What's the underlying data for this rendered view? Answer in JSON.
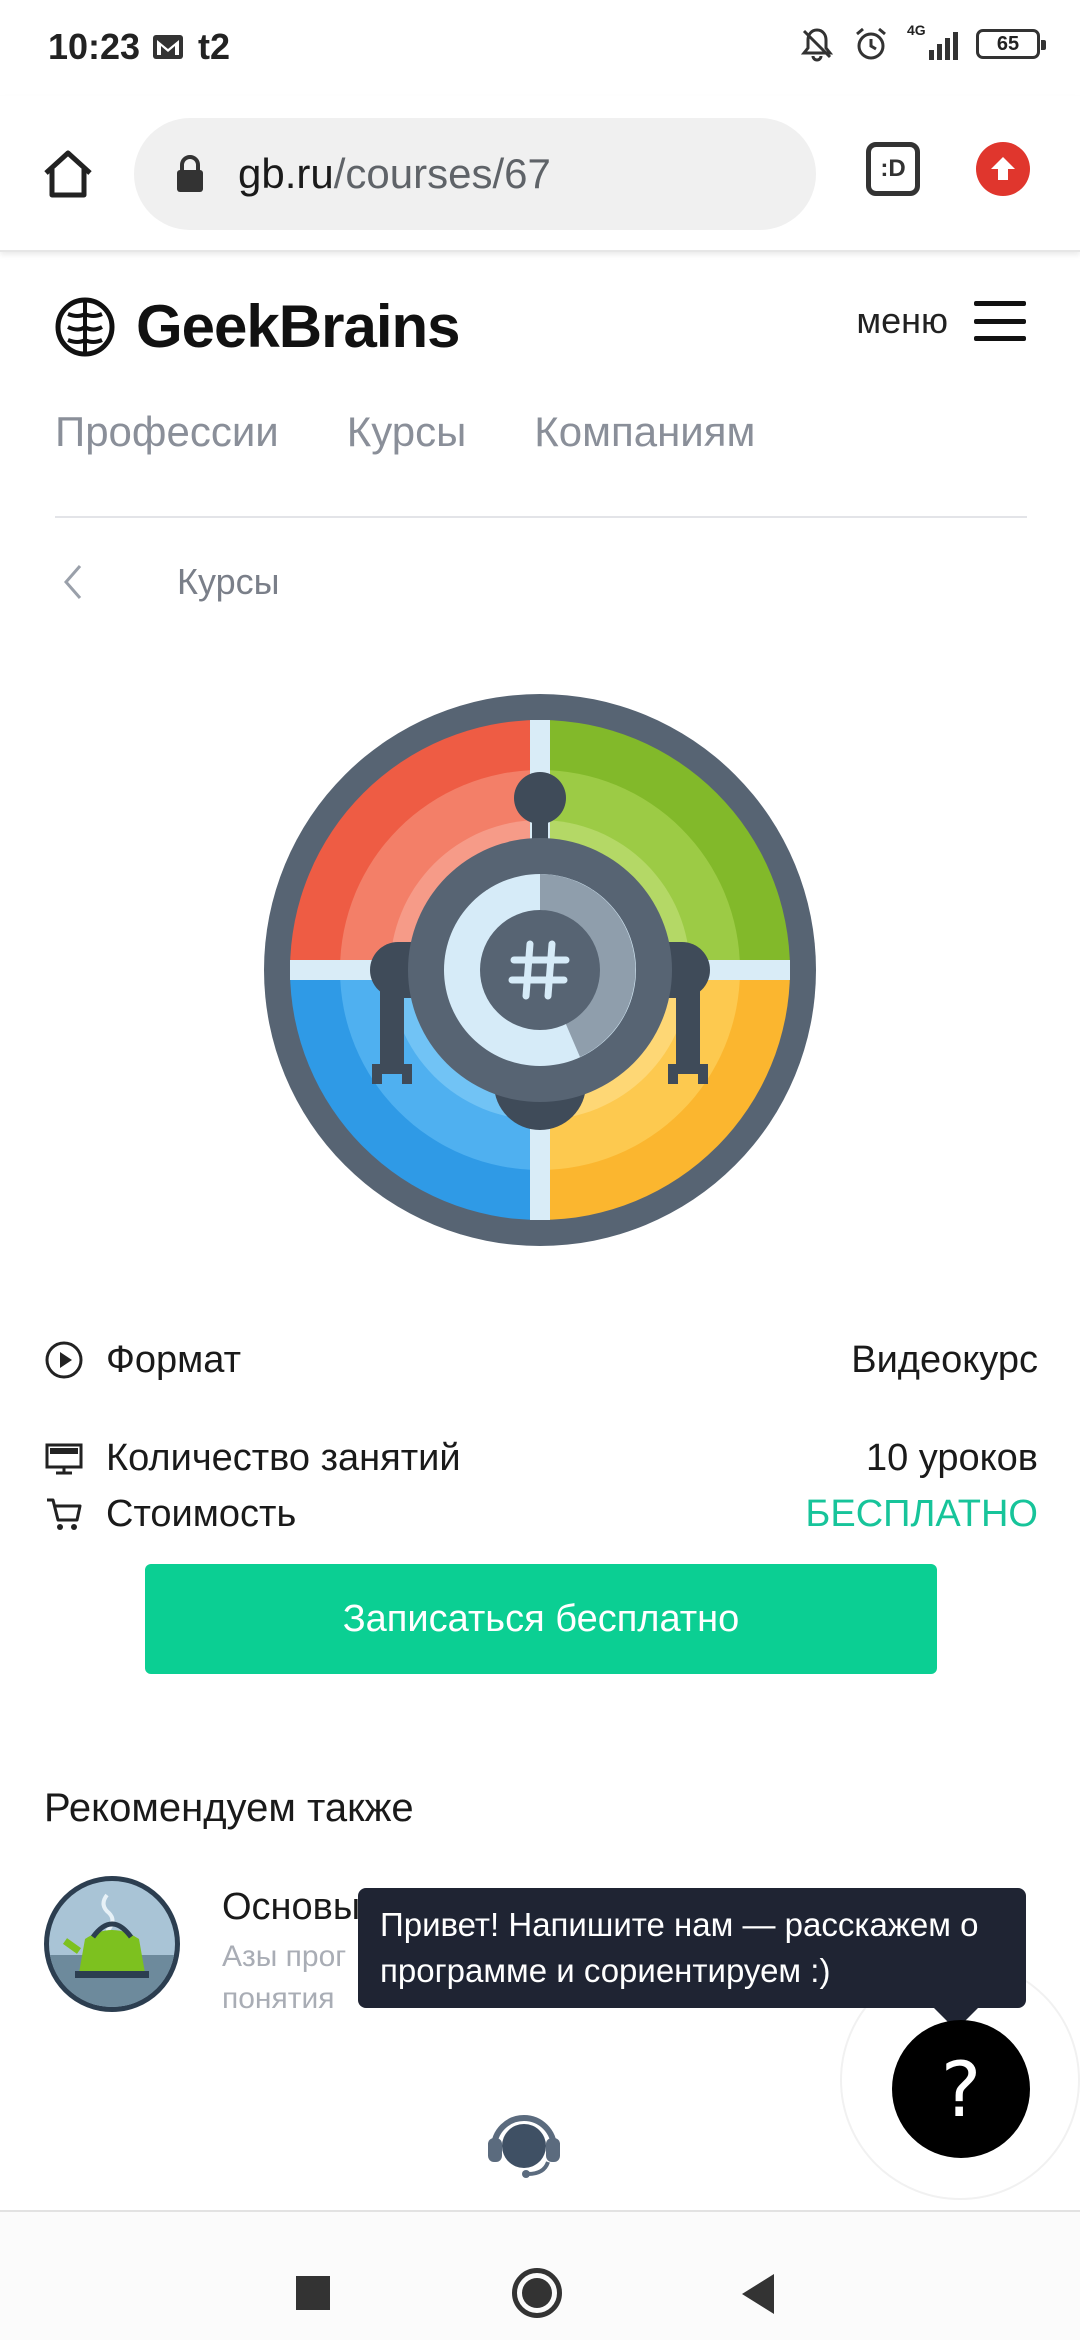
{
  "status_bar": {
    "time": "10:23",
    "carrier": "t2",
    "network": "4G",
    "battery": "65",
    "icons": [
      "gmail-icon",
      "bell-off-icon",
      "alarm-icon",
      "signal-icon"
    ]
  },
  "browser": {
    "url_domain": "gb.ru",
    "url_path": "/courses/67",
    "tabs_label": ":D"
  },
  "site": {
    "logo_text": "GeekBrains",
    "menu_label": "меню",
    "nav": [
      "Профессии",
      "Курсы",
      "Компаниям"
    ]
  },
  "breadcrumb": {
    "label": "Курсы"
  },
  "course": {
    "rows": [
      {
        "label": "Формат",
        "value": "Видеокурс"
      },
      {
        "label": "Количество занятий",
        "value": "10 уроков"
      },
      {
        "label": "Стоимость",
        "value": "БЕСПЛАТНО"
      }
    ],
    "enroll_label": "Записаться бесплатно"
  },
  "recommend": {
    "title": "Рекомендуем также",
    "card_title": "Основы",
    "card_desc_line1": "Азы прог",
    "card_desc_line2": "понятия"
  },
  "chat": {
    "tooltip": "Привет! Напишите нам — расскажем о программе и сориентируем :)",
    "fab_label": "?"
  },
  "colors": {
    "accent_green": "#0bcf93",
    "free_text": "#17c49a",
    "tooltip_bg": "#1f2433"
  }
}
